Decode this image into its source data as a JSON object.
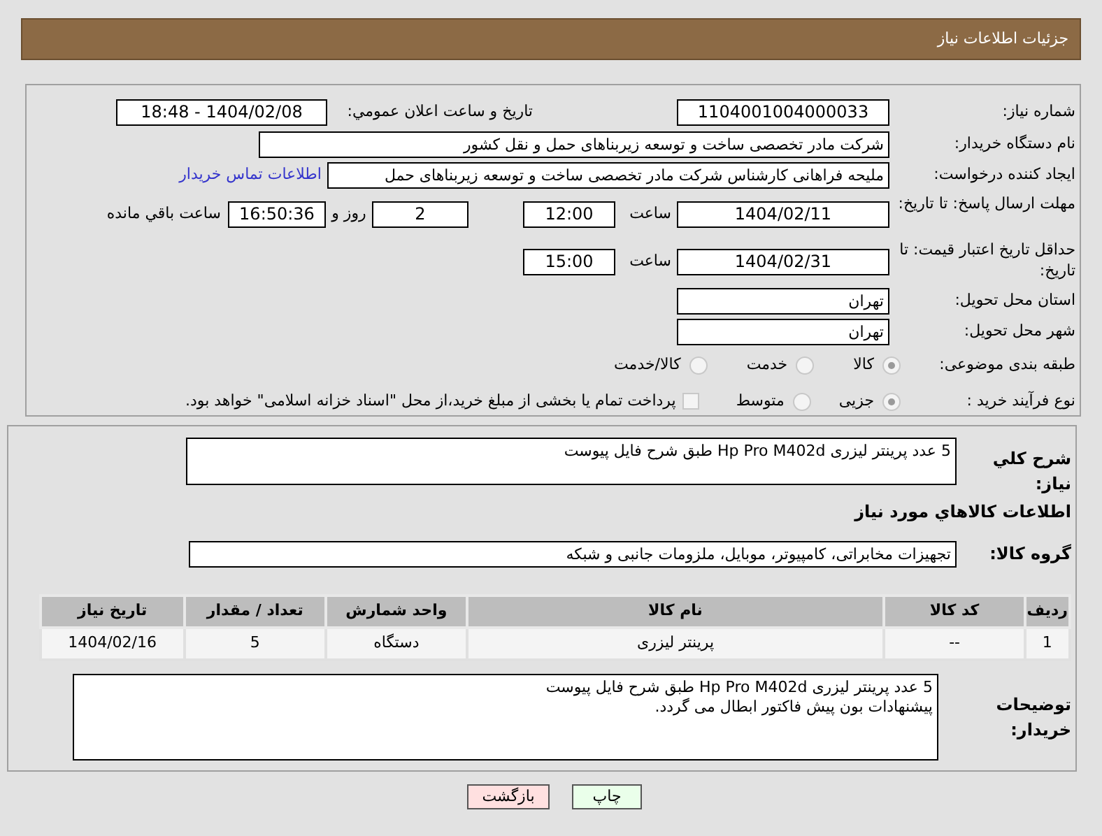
{
  "header": {
    "title": "جزئیات اطلاعات نیاز"
  },
  "details": {
    "need_number": {
      "label": "شماره نیاز:",
      "value": "1104001004000033"
    },
    "announce": {
      "label": "تاریخ و ساعت اعلان عمومي:",
      "value": "1404/02/08 - 18:48"
    },
    "buyer_org": {
      "label": "نام دستگاه خریدار:",
      "value": "شرکت مادر تخصصی ساخت و توسعه زیربناهای حمل و نقل کشور"
    },
    "requester": {
      "label": "ایجاد کننده درخواست:",
      "value": "ملیحه فراهانی کارشناس شرکت مادر تخصصی ساخت و توسعه زیربناهای حمل",
      "link": "اطلاعات تماس خریدار"
    },
    "reply_deadline": {
      "label": "مهلت ارسال پاسخ: تا تاریخ:",
      "date": "1404/02/11",
      "time_label": "ساعت",
      "time": "12:00",
      "days": "2",
      "days_label": "روز و",
      "remaining": "16:50:36",
      "remaining_label": "ساعت باقي مانده"
    },
    "price_validity": {
      "label": "حداقل تاریخ اعتبار قیمت: تا تاریخ:",
      "date": "1404/02/31",
      "time_label": "ساعت",
      "time": "15:00"
    },
    "province": {
      "label": "استان محل تحویل:",
      "value": "تهران"
    },
    "city": {
      "label": "شهر محل تحویل:",
      "value": "تهران"
    },
    "category": {
      "label": "طبقه بندی موضوعی:",
      "options": [
        {
          "label": "کالا",
          "selected": true
        },
        {
          "label": "خدمت",
          "selected": false
        },
        {
          "label": "کالا/خدمت",
          "selected": false
        }
      ]
    },
    "process": {
      "label": "نوع فرآیند خرید :",
      "options": [
        {
          "label": "جزیی",
          "selected": true
        },
        {
          "label": "متوسط",
          "selected": false
        }
      ],
      "treasury": {
        "label": "پرداخت تمام یا بخشی از مبلغ خرید،از محل \"اسناد خزانه اسلامی\" خواهد بود.",
        "checked": false
      }
    }
  },
  "description": {
    "label": "شرح کلي نیاز:",
    "value": "5 عدد پرینتر لیزری  Hp Pro M402d طبق شرح فایل پیوست"
  },
  "goods": {
    "title": "اطلاعات کالاهاي مورد نیاز",
    "group_label": "گروه کالا:",
    "group": "تجهیزات مخابراتی، کامپیوتر، موبایل، ملزومات جانبی و شبکه",
    "table": {
      "columns": [
        "ردیف",
        "کد کالا",
        "نام کالا",
        "واحد شمارش",
        "تعداد / مقدار",
        "تاریخ نیاز"
      ],
      "rows": [
        [
          "1",
          "--",
          "پرینتر لیزری",
          "دستگاه",
          "5",
          "1404/02/16"
        ]
      ]
    }
  },
  "buyer_notes": {
    "label": "توضیحات خریدار:",
    "lines": [
      "5 عدد پرینتر لیزری  Hp Pro M402d طبق شرح فایل پیوست",
      "پیشنهادات بون پیش فاکتور ابطال می گردد."
    ]
  },
  "buttons": [
    {
      "kind": "print",
      "label": "چاپ"
    },
    {
      "kind": "back",
      "label": "بازگشت"
    }
  ]
}
